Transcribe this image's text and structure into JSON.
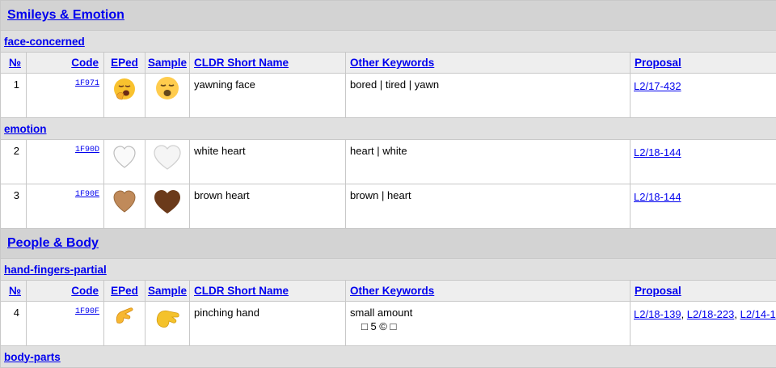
{
  "columns": {
    "num": "№",
    "code": "Code",
    "eped": "EPed",
    "sample": "Sample",
    "name": "CLDR Short Name",
    "keywords": "Other Keywords",
    "proposal": "Proposal"
  },
  "sections": [
    {
      "title": "Smileys & Emotion",
      "subgroups": [
        {
          "title": "face-concerned",
          "rows": [
            {
              "num": "1",
              "code": "1F971",
              "name": "yawning face",
              "keywords": "bored | tired | yawn",
              "proposals": [
                "L2/17-432"
              ],
              "icon": "yawning-face-icon"
            }
          ]
        },
        {
          "title": "emotion",
          "rows": [
            {
              "num": "2",
              "code": "1F90D",
              "name": "white heart",
              "keywords": "heart | white",
              "proposals": [
                "L2/18-144"
              ],
              "icon": "white-heart-icon"
            },
            {
              "num": "3",
              "code": "1F90E",
              "name": "brown heart",
              "keywords": "brown | heart",
              "proposals": [
                "L2/18-144"
              ],
              "icon": "brown-heart-icon"
            }
          ]
        }
      ]
    },
    {
      "title": "People & Body",
      "subgroups": [
        {
          "title": "hand-fingers-partial",
          "rows": [
            {
              "num": "4",
              "code": "1F90F",
              "name": "pinching hand",
              "keywords": "small amount",
              "keywords_extra": "□ 5 © □",
              "proposals": [
                "L2/18-139",
                "L2/18-223",
                "L2/14-1"
              ],
              "icon": "pinching-hand-icon"
            }
          ]
        },
        {
          "title": "body-parts"
        }
      ]
    }
  ],
  "colors": {
    "link": "#0000ee",
    "section_bg": "#d3d3d3",
    "subgroup_bg": "#e0e0e0",
    "header_bg": "#eeeeee"
  }
}
